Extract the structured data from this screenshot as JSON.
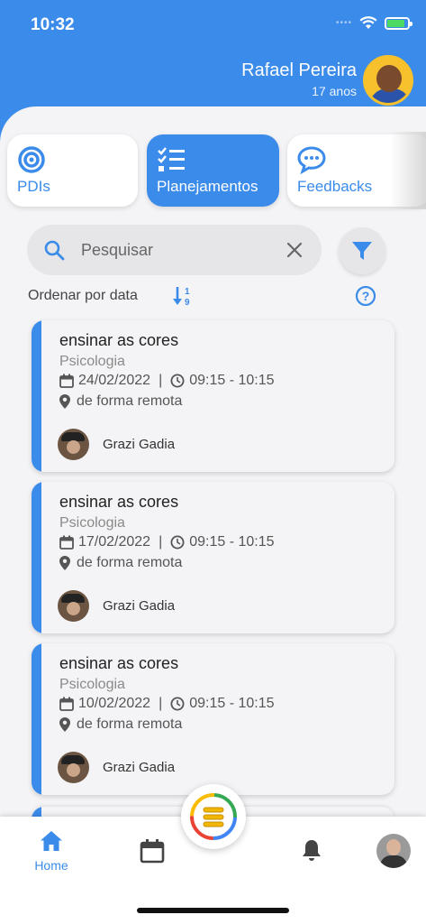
{
  "status_bar": {
    "time": "10:32",
    "signal_dots": "••••"
  },
  "user": {
    "name": "Rafael Pereira",
    "age": "17 anos"
  },
  "tabs": [
    {
      "label": "PDIs",
      "icon": "target-icon",
      "active": false
    },
    {
      "label": "Planejamentos",
      "icon": "checklist-icon",
      "active": true
    },
    {
      "label": "Feedbacks",
      "icon": "chat-bubble-icon",
      "active": false
    }
  ],
  "search": {
    "placeholder": "Pesquisar",
    "value": ""
  },
  "sort": {
    "label": "Ordenar por data"
  },
  "cards": [
    {
      "title": "ensinar as cores",
      "subject": "Psicologia",
      "date": "24/02/2022",
      "time": "09:15 - 10:15",
      "location": "de forma remota",
      "person": "Grazi Gadia"
    },
    {
      "title": "ensinar as cores",
      "subject": "Psicologia",
      "date": "17/02/2022",
      "time": "09:15 - 10:15",
      "location": "de forma remota",
      "person": "Grazi Gadia"
    },
    {
      "title": "ensinar as cores",
      "subject": "Psicologia",
      "date": "10/02/2022",
      "time": "09:15 - 10:15",
      "location": "de forma remota",
      "person": "Grazi Gadia"
    }
  ],
  "nav": {
    "home_label": "Home"
  },
  "colors": {
    "primary": "#3b8bea",
    "background": "#f4f4f6"
  }
}
